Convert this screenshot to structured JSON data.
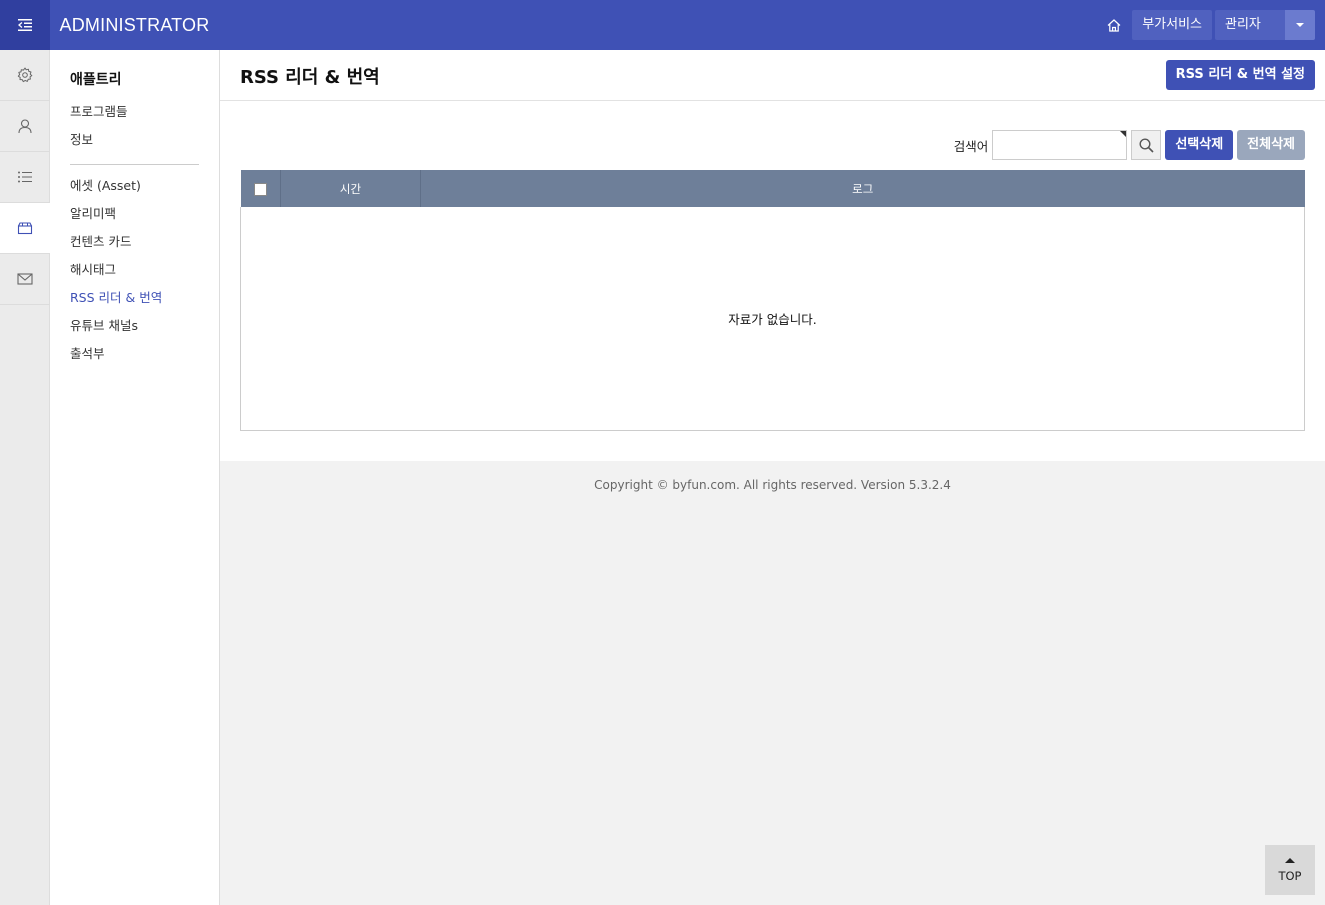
{
  "header": {
    "brand": "ADMINISTRATOR",
    "home_icon": "home-icon",
    "menu_icon": "menu-collapse-icon",
    "addon_label": "부가서비스",
    "admin_label": "관리자",
    "colors": {
      "primary": "#3f51b5",
      "primary_dark": "#303f9f"
    }
  },
  "rail": {
    "items": [
      {
        "icon": "gear-icon"
      },
      {
        "icon": "user-icon"
      },
      {
        "icon": "list-icon"
      },
      {
        "icon": "app-store-icon",
        "active": true
      },
      {
        "icon": "mail-icon"
      }
    ]
  },
  "subnav": {
    "title": "애플트리",
    "group1": [
      "프로그램들",
      "정보"
    ],
    "group2": [
      "에셋 (Asset)",
      "알리미팩",
      "컨텐츠 카드",
      "해시태그",
      "RSS 리더 & 번역",
      "유튜브 채널s",
      "출석부"
    ],
    "active": "RSS 리더 & 번역"
  },
  "page": {
    "title": "RSS 리더 & 번역",
    "settings_button": "RSS 리더 & 번역 설정"
  },
  "search": {
    "label": "검색어",
    "value": "",
    "delete_selected": "선택삭제",
    "delete_all": "전체삭제"
  },
  "table": {
    "columns": [
      "시간",
      "로그"
    ],
    "rows": [],
    "empty_message": "자료가 없습니다."
  },
  "footer": {
    "copyright": "Copyright © byfun.com. All rights reserved. Version 5.3.2.4"
  },
  "scroll_top": {
    "label": "TOP"
  }
}
